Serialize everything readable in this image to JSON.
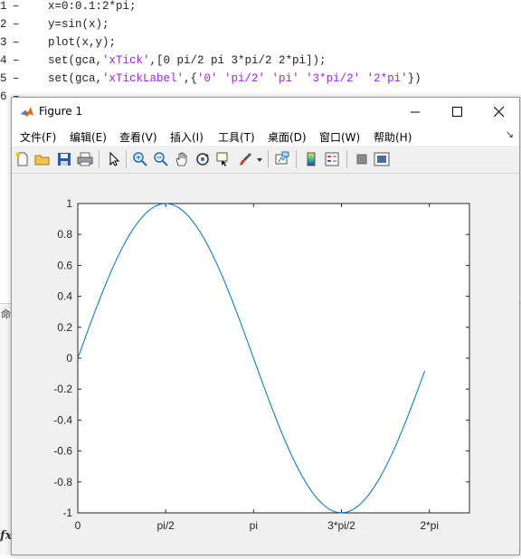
{
  "editor": {
    "lines": [
      {
        "num": "1",
        "parts": [
          {
            "t": "x=0:0.1:2*pi;",
            "c": "kw"
          }
        ]
      },
      {
        "num": "2",
        "parts": [
          {
            "t": "y=sin(x);",
            "c": "kw"
          }
        ]
      },
      {
        "num": "3",
        "parts": [
          {
            "t": "plot(x,y);",
            "c": "kw"
          }
        ]
      },
      {
        "num": "4",
        "parts": [
          {
            "t": "set(gca,",
            "c": "kw"
          },
          {
            "t": "'xTick'",
            "c": "str"
          },
          {
            "t": ",[0 pi/2 pi 3*pi/2 2*pi]);",
            "c": "kw"
          }
        ]
      },
      {
        "num": "5",
        "parts": [
          {
            "t": "set(gca,",
            "c": "kw"
          },
          {
            "t": "'xTickLabel'",
            "c": "str"
          },
          {
            "t": ",{",
            "c": "kw"
          },
          {
            "t": "'0' 'pi/2' 'pi' '3*pi/2' '2*pi'",
            "c": "str"
          },
          {
            "t": "})",
            "c": "kw"
          }
        ]
      },
      {
        "num": "6",
        "parts": []
      }
    ],
    "command_window_char": "命",
    "fx_label": "fx"
  },
  "figure": {
    "title": "Figure 1",
    "menus": [
      "文件(F)",
      "编辑(E)",
      "查看(V)",
      "插入(I)",
      "工具(T)",
      "桌面(D)",
      "窗口(W)",
      "帮助(H)"
    ],
    "toolbar_icons": [
      "new-figure-icon",
      "open-file-icon",
      "save-icon",
      "print-icon",
      "pointer-icon",
      "zoom-in-icon",
      "zoom-out-icon",
      "pan-hand-icon",
      "rotate-3d-icon",
      "data-cursor-icon",
      "brush-icon",
      "brush-dropdown-icon",
      "link-plot-icon",
      "colorbar-icon",
      "legend-icon",
      "hide-plot-tools-icon",
      "show-plot-tools-icon"
    ],
    "line_color": "#0072BD"
  },
  "chart_data": {
    "type": "line",
    "title": "",
    "xlabel": "",
    "ylabel": "",
    "xlim": [
      0,
      7
    ],
    "ylim": [
      -1,
      1
    ],
    "x_ticks": [
      0,
      1.5708,
      3.1416,
      4.7124,
      6.2832
    ],
    "x_tick_labels": [
      "0",
      "pi/2",
      "pi",
      "3*pi/2",
      "2*pi"
    ],
    "y_ticks": [
      -1,
      -0.8,
      -0.6,
      -0.4,
      -0.2,
      0,
      0.2,
      0.4,
      0.6,
      0.8,
      1
    ],
    "y_tick_labels": [
      "-1",
      "-0.8",
      "-0.6",
      "-0.4",
      "-0.2",
      "0",
      "0.2",
      "0.4",
      "0.6",
      "0.8",
      "1"
    ],
    "grid": false,
    "series": [
      {
        "function": "sin(x)",
        "x_start": 0,
        "x_step": 0.1,
        "x_end": 6.2
      }
    ]
  }
}
